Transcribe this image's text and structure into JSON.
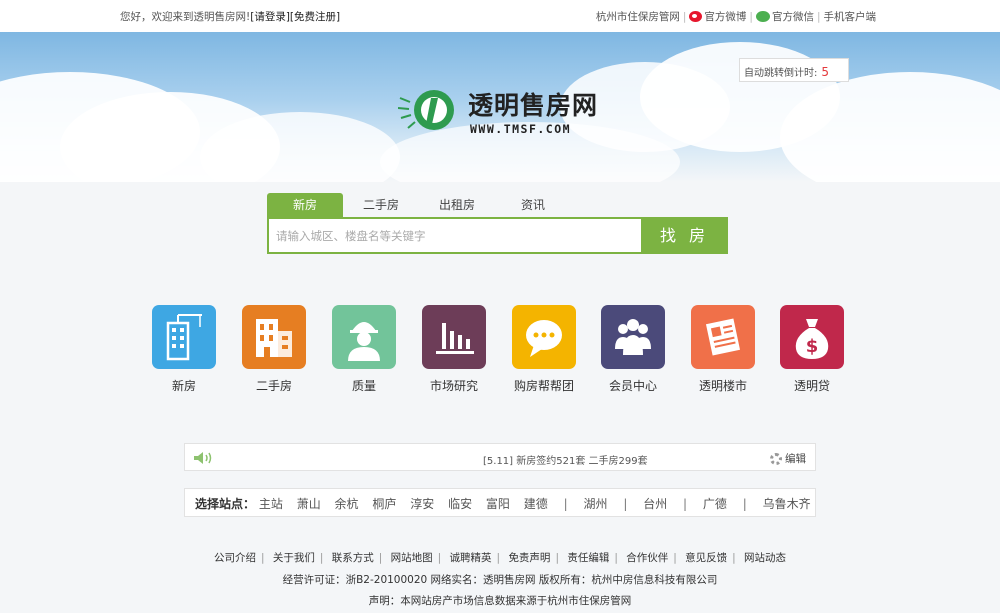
{
  "topbar": {
    "welcome": "您好，欢迎来到透明售房网!",
    "login": "[请登录]",
    "register": "[免费注册]",
    "links": [
      {
        "label": "杭州市住保房管网",
        "icon": ""
      },
      {
        "label": "官方微博",
        "icon": "weibo-icon"
      },
      {
        "label": "官方微信",
        "icon": "wechat-icon"
      },
      {
        "label": "手机客户端",
        "icon": ""
      }
    ]
  },
  "countdown": {
    "label": "自动跳转倒计时:",
    "value": "5"
  },
  "logo": {
    "name": "透明售房网",
    "url": "WWW.TMSF.COM"
  },
  "search": {
    "tabs": [
      "新房",
      "二手房",
      "出租房",
      "资讯"
    ],
    "active_tab": 0,
    "placeholder": "请输入城区、楼盘名等关键字",
    "button": "找 房"
  },
  "apps": [
    {
      "label": "新房",
      "color": "#3ea7e3",
      "icon": "building-crane-icon"
    },
    {
      "label": "二手房",
      "color": "#e67e22",
      "icon": "office-building-icon"
    },
    {
      "label": "质量",
      "color": "#72c49a",
      "icon": "worker-helmet-icon"
    },
    {
      "label": "市场研究",
      "color": "#6d3d58",
      "icon": "bar-chart-icon"
    },
    {
      "label": "购房帮帮团",
      "color": "#f4b400",
      "icon": "chat-bubble-icon"
    },
    {
      "label": "会员中心",
      "color": "#4b4a7a",
      "icon": "people-group-icon"
    },
    {
      "label": "透明楼市",
      "color": "#f07049",
      "icon": "newspaper-icon"
    },
    {
      "label": "透明贷",
      "color": "#c0284b",
      "icon": "money-bag-icon"
    }
  ],
  "notice": {
    "text": "[5.11] 新房签约521套  二手房299套",
    "edit": "编辑"
  },
  "stations": {
    "title": "选择站点：",
    "group1": [
      "主站",
      "萧山",
      "余杭",
      "桐庐",
      "淳安",
      "临安",
      "富阳",
      "建德"
    ],
    "group2": [
      "湖州",
      "台州",
      "广德",
      "乌鲁木齐"
    ]
  },
  "footer": {
    "links": [
      "公司介绍",
      "关于我们",
      "联系方式",
      "网站地图",
      "诚聘精英",
      "免责声明",
      "责任编辑",
      "合作伙伴",
      "意见反馈",
      "网站动态"
    ],
    "license": "经营许可证：浙B2-20100020  网络实名：透明售房网  版权所有：杭州中房信息科技有限公司",
    "statement": "声明：本网站房产市场信息数据来源于杭州市住保房管网"
  }
}
